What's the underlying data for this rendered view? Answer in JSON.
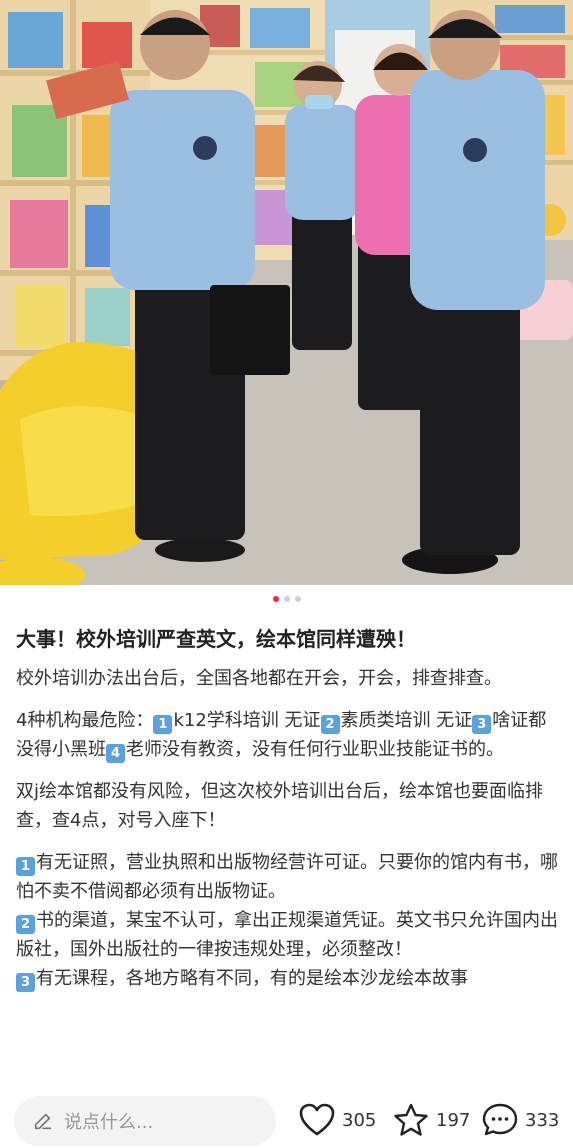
{
  "post": {
    "title": "大事！校外培训严查英文，绘本馆同样遭殃！",
    "p1": "校外培训办法出台后，全国各地都在开会，开会，排查排查。",
    "p2_intro": "4种机构最危险：",
    "p2_items": [
      "k12学科培训 无证",
      "素质类培训 无证",
      "啥证都没得小黑班",
      "老师没有教资，没有任何行业职业技能证书的。"
    ],
    "p3": "双j绘本馆都没有风险，但这次校外培训出台后，绘本馆也要面临排查，查4点，对号入座下！",
    "p4": "有无证照，营业执照和出版物经营许可证。只要你的馆内有书，哪怕不卖不借阅都必须有出版物证。",
    "p5": "书的渠道，某宝不认可，拿出正规渠道凭证。英文书只允许国内出版社，国外出版社的一律按违规处理，必须整改！",
    "p6": "有无课程，各地方略有不同，有的是绘本沙龙绘本故事"
  },
  "numbers": [
    "1",
    "2",
    "3",
    "4"
  ],
  "carousel": {
    "total": 3,
    "active": 0
  },
  "bottom": {
    "comment_placeholder": "说点什么...",
    "likes": "305",
    "favorites": "197",
    "comments": "333"
  },
  "colors": {
    "accent": "#ff2442",
    "emoji_num": "#5aa2dc"
  }
}
